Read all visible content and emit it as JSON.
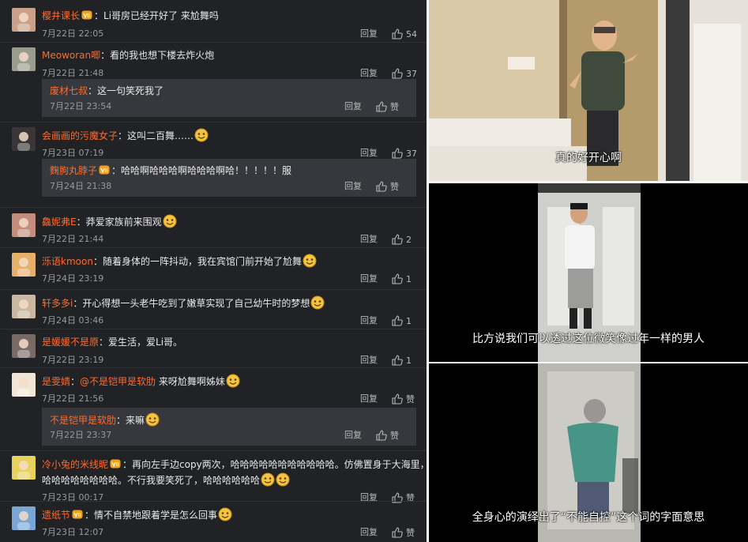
{
  "comments": [
    {
      "user": "樱井课长",
      "vip": true,
      "text": "：Li哥房已经开好了 来尬舞吗",
      "time": "7月22日 22:05",
      "reply": "回复",
      "likes": "54"
    },
    {
      "user": "Meoworan唧",
      "vip": false,
      "text": "：看的我也想下楼去炸火炮",
      "time": "7月22日 21:48",
      "reply": "回复",
      "likes": "37",
      "sub": {
        "user": "废材七叔",
        "text": "：这一句笑死我了",
        "time": "7月22日 23:54",
        "reply": "回复",
        "likes": "赞"
      }
    },
    {
      "user": "会画画的污魔女子",
      "vip": false,
      "text": "：这叫二百舞……",
      "time": "7月23日 07:19",
      "reply": "回复",
      "likes": "37",
      "sub": {
        "user": "麴朐丸脖子",
        "text": "：哈哈啊哈哈哈啊哈哈哈啊哈！！！！！服",
        "time": "7月24日 21:38",
        "reply": "回复",
        "likes": "赞"
      }
    },
    {
      "user": "鱻妮弗E",
      "vip": false,
      "text": "：莽爱家族前来围观",
      "time": "7月22日 21:44",
      "reply": "回复",
      "likes": "2"
    },
    {
      "user": "泺语kmoon",
      "vip": false,
      "text": "：随着身体的一阵抖动，我在宾馆门前开始了尬舞",
      "time": "7月24日 23:19",
      "reply": "回复",
      "likes": "1"
    },
    {
      "user": "轩多多i",
      "vip": false,
      "text": "：开心得想一头老牛吃到了嫩草实现了自己幼牛时的梦想",
      "time": "7月24日 03:46",
      "reply": "回复",
      "likes": "1"
    },
    {
      "user": "是媛媛不是原",
      "vip": false,
      "text": "：爱生活，爱Li哥。",
      "time": "7月22日 23:19",
      "reply": "回复",
      "likes": "1"
    },
    {
      "user": "是雯婧",
      "vip": false,
      "text": "：@不是铠甲是软肋 来呀尬舞啊姊妹",
      "mention": "@不是铠甲是软肋",
      "time": "7月22日 21:56",
      "reply": "回复",
      "likes": "赞",
      "sub": {
        "user": "不是铠甲是软肋",
        "text": "：来嘛",
        "time": "7月22日 23:37",
        "reply": "回复",
        "likes": "赞"
      }
    },
    {
      "user": "冷小兔的米线昵",
      "vip": true,
      "text": "：再向左手边copy两次，哈哈哈哈哈哈哈哈哈哈哈。仿佛置身于大海里，哈",
      "text2": "哈哈哈哈哈哈哈哈。不行我要笑死了，哈哈哈哈哈哈",
      "time": "7月23日 00:17",
      "reply": "回复",
      "likes": "赞"
    },
    {
      "user": "遗纸节",
      "vip": true,
      "text": "：情不自禁地跟着学是怎么回事",
      "time": "7月23日 12:07",
      "reply": "回复",
      "likes": "赞"
    }
  ],
  "videos": [
    {
      "subtitle": "真的好开心啊"
    },
    {
      "subtitle": "比方说我们可以透过这位微笑像过年一样的男人"
    },
    {
      "subtitle": "全身心的演绎出了“不能自控”这个词的字面意思"
    }
  ],
  "colors": {
    "panel_bg": "#202226",
    "username": "#ff6b2d",
    "reply_bg": "#36383d"
  }
}
